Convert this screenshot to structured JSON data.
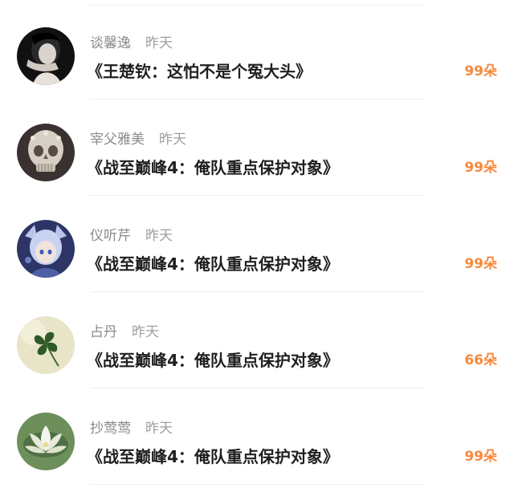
{
  "messages": [
    {
      "username": "谈馨逸",
      "time": "昨天",
      "title": "《王楚钦：这怕不是个冤大头》",
      "gift": "99朵"
    },
    {
      "username": "宰父雅美",
      "time": "昨天",
      "title": "《战至巅峰4：俺队重点保护对象》",
      "gift": "99朵"
    },
    {
      "username": "仪听芹",
      "time": "昨天",
      "title": "《战至巅峰4：俺队重点保护对象》",
      "gift": "99朵"
    },
    {
      "username": "占丹",
      "time": "昨天",
      "title": "《战至巅峰4：俺队重点保护对象》",
      "gift": "66朵"
    },
    {
      "username": "抄莺莺",
      "time": "昨天",
      "title": "《战至巅峰4：俺队重点保护对象》",
      "gift": "99朵"
    }
  ],
  "colors": {
    "gift": "#f5893d",
    "username": "#8a8a8a",
    "title": "#1f1f1f"
  },
  "avatars": [
    "portrait-avatar",
    "skull-avatar",
    "anime-avatar",
    "clover-avatar",
    "lotus-avatar"
  ]
}
